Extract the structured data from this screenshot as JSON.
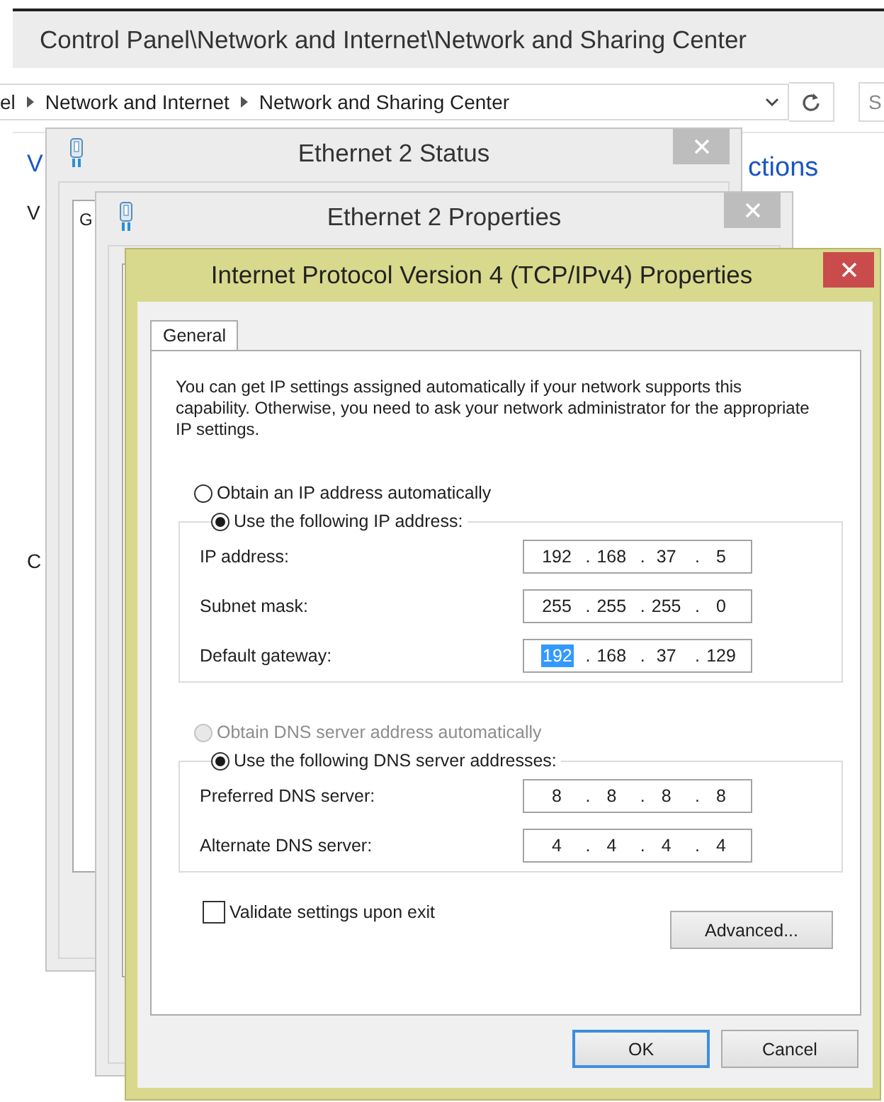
{
  "explorer": {
    "title": "Control Panel\\Network and Internet\\Network and Sharing Center",
    "breadcrumb": [
      "el",
      "Network and Internet",
      "Network and Sharing Center"
    ],
    "search_placeholder": "S",
    "content_left": [
      {
        "text": "V",
        "kind": "link"
      },
      {
        "text": "V",
        "kind": "text"
      },
      {
        "text": "C",
        "kind": "text"
      }
    ],
    "content_right": {
      "text": "ctions",
      "kind": "link"
    }
  },
  "status_window": {
    "title": "Ethernet 2 Status",
    "tab": "G"
  },
  "properties_window": {
    "title": "Ethernet 2 Properties"
  },
  "ipv4_dialog": {
    "title": "Internet Protocol Version 4 (TCP/IPv4) Properties",
    "tabs": [
      {
        "label": "General",
        "selected": true
      }
    ],
    "description": "You can get IP settings assigned automatically if your network supports this capability. Otherwise, you need to ask your network administrator for the appropriate IP settings.",
    "ip_auto": {
      "label": "Obtain an IP address automatically",
      "selected": false,
      "disabled": false
    },
    "ip_manual": {
      "label": "Use the following IP address:",
      "selected": true,
      "disabled": false
    },
    "ip_fields": [
      {
        "label": "IP address:",
        "octets": [
          {
            "text": "192",
            "dot": ".",
            "selected": false
          },
          {
            "text": "168",
            "dot": ".",
            "selected": false
          },
          {
            "text": "37",
            "dot": ".",
            "selected": false
          },
          {
            "text": "5",
            "selected": false
          }
        ]
      },
      {
        "label": "Subnet mask:",
        "octets": [
          {
            "text": "255",
            "dot": ".",
            "selected": false
          },
          {
            "text": "255",
            "dot": ".",
            "selected": false
          },
          {
            "text": "255",
            "dot": ".",
            "selected": false
          },
          {
            "text": "0",
            "selected": false
          }
        ]
      },
      {
        "label": "Default gateway:",
        "octets": [
          {
            "text": "192",
            "dot": ".",
            "selected": true
          },
          {
            "text": "168",
            "dot": ".",
            "selected": false
          },
          {
            "text": "37",
            "dot": ".",
            "selected": false
          },
          {
            "text": "129",
            "selected": false
          }
        ]
      }
    ],
    "dns_auto": {
      "label": "Obtain DNS server address automatically",
      "selected": false,
      "disabled": true
    },
    "dns_manual": {
      "label": "Use the following DNS server addresses:",
      "selected": true,
      "disabled": false
    },
    "dns_fields": [
      {
        "label": "Preferred DNS server:",
        "octets": [
          {
            "text": "8",
            "dot": ".",
            "selected": false
          },
          {
            "text": "8",
            "dot": ".",
            "selected": false
          },
          {
            "text": "8",
            "dot": ".",
            "selected": false
          },
          {
            "text": "8",
            "selected": false
          }
        ]
      },
      {
        "label": "Alternate DNS server:",
        "octets": [
          {
            "text": "4",
            "dot": ".",
            "selected": false
          },
          {
            "text": "4",
            "dot": ".",
            "selected": false
          },
          {
            "text": "4",
            "dot": ".",
            "selected": false
          },
          {
            "text": "4",
            "selected": false
          }
        ]
      }
    ],
    "validate": {
      "label": "Validate settings upon exit",
      "checked": false
    },
    "advanced_button": "Advanced...",
    "buttons": [
      {
        "label": "OK",
        "default": true
      },
      {
        "label": "Cancel",
        "default": false
      }
    ]
  }
}
